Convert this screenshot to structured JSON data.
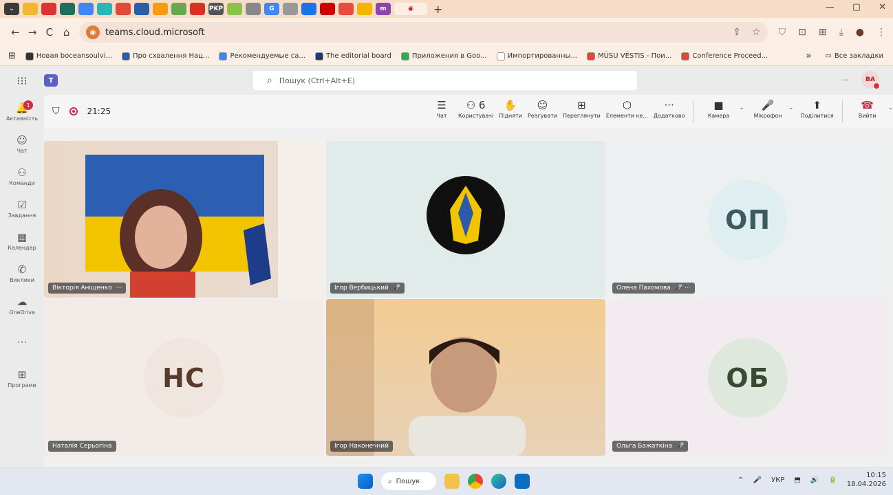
{
  "browser": {
    "tabs": [
      "⌄",
      "",
      "",
      "",
      "",
      "",
      "",
      "",
      "",
      "",
      "",
      "PKP",
      "",
      "",
      "G",
      "",
      "",
      "",
      "",
      "",
      "m"
    ],
    "tab_colors": [
      "#3a3a3a",
      "#f2b632",
      "#d33",
      "#1e6f5c",
      "#4285f4",
      "#2bb5b3",
      "#e04a3a",
      "#2a5fa8",
      "#f39c12",
      "#6aa84f",
      "#d93025",
      "#555",
      "#8bc34a",
      "#888",
      "#4285f4",
      "#999",
      "#1a73e8",
      "#cc0000",
      "#e74c3c",
      "#f4b400",
      "#8e44ad"
    ],
    "active_tab_icon": "◉",
    "new_tab": "+",
    "window_controls": [
      "—",
      "▢",
      "✕"
    ],
    "nav": {
      "back": "←",
      "forward": "→",
      "reload": "C",
      "home": "⌂"
    },
    "url": "teams.cloud.microsoft",
    "omni_icons": [
      "⇪",
      "☆"
    ],
    "extension_icons": [
      "⛉",
      "⊡",
      "⊞",
      "⤓",
      "●",
      "⋮"
    ]
  },
  "bookmarks": {
    "apps_icon": "⊞",
    "items": [
      {
        "label": "Новая boceansoulvi...",
        "color": "#333"
      },
      {
        "label": "Про схвалення Нац...",
        "color": "#2a5fa8"
      },
      {
        "label": "Рекомендуемые са...",
        "color": "#4285f4"
      },
      {
        "label": "The editorial board",
        "color": "#1e3a6e"
      },
      {
        "label": "Приложения в Goo...",
        "color": "#34a853"
      },
      {
        "label": "Импортированны...",
        "color": "#ffffff"
      },
      {
        "label": "MŪSU VĒSTIS - Пои...",
        "color": "#ea4335"
      },
      {
        "label": "Conference Proceed...",
        "color": "#ea4335"
      }
    ],
    "more": "»",
    "all_bookmarks": "Все закладки"
  },
  "teams_header": {
    "app_grid": "⁝⁝⁝",
    "logo": "T",
    "search_placeholder": "Пошук (Ctrl+Alt+E)",
    "search_icon": "⌕",
    "more": "···",
    "avatar_initials": "BA"
  },
  "rail": {
    "items": [
      {
        "icon": "🔔",
        "label": "Активність"
      },
      {
        "icon": "☺",
        "label": "Чат"
      },
      {
        "icon": "⚇",
        "label": "Команди"
      },
      {
        "icon": "☑",
        "label": "Завдання"
      },
      {
        "icon": "▦",
        "label": "Календар"
      },
      {
        "icon": "✆",
        "label": "Виклики"
      },
      {
        "icon": "☁",
        "label": "OneDrive"
      },
      {
        "icon": "···",
        "label": ""
      },
      {
        "icon": "⊞",
        "label": "Програми"
      }
    ],
    "activity_badge": "1"
  },
  "meeting_bar": {
    "shield_icon": "⛉",
    "elapsed": "21:25",
    "buttons": [
      {
        "icon": "☰",
        "label": "Чат"
      },
      {
        "icon": "⚇ 6",
        "label": "Користувачі"
      },
      {
        "icon": "✋",
        "label": "Підняти"
      },
      {
        "icon": "☺",
        "label": "Реагувати"
      },
      {
        "icon": "⊞",
        "label": "Переглянути"
      },
      {
        "icon": "⬡",
        "label": "Елементи ке..."
      },
      {
        "icon": "···",
        "label": "Додатково"
      }
    ],
    "camera": {
      "icon": "■",
      "label": "Камера"
    },
    "mic": {
      "icon": "🎤",
      "label": "Мікрофон"
    },
    "share": {
      "icon": "⬆",
      "label": "Поділитися"
    },
    "leave": {
      "icon": "☎",
      "label": "Вийти"
    },
    "chevron": "⌄"
  },
  "participants": [
    {
      "name": "Вікторія Аніщенко",
      "suffix": "···",
      "type": "video-woman"
    },
    {
      "name": "Ігор Вербицький",
      "suffix": "🎤̸",
      "type": "logo"
    },
    {
      "name": "Олена Пахомова",
      "suffix": "🎤̸ ···",
      "type": "initials",
      "initials": "ОП",
      "circle": "#dfeef0",
      "text": "#3d5a5e"
    },
    {
      "name": "Наталія Серьогіна",
      "suffix": "",
      "type": "initials",
      "initials": "НС",
      "circle": "#efe6df",
      "text": "#5a3a2a"
    },
    {
      "name": "Ігор Наконечний",
      "suffix": "",
      "type": "video-man"
    },
    {
      "name": "Ольга Бажаткіна",
      "suffix": "🎤̸",
      "type": "initials",
      "initials": "ОБ",
      "circle": "#dfe8dc",
      "text": "#3a4a30"
    }
  ],
  "taskbar": {
    "search_label": "Пошук",
    "search_icon": "⌕",
    "tray": [
      "^",
      "🎤",
      "УКР",
      "⬒",
      "🔊",
      "🔋"
    ],
    "time": "10:15",
    "date": "18.04.2026"
  }
}
